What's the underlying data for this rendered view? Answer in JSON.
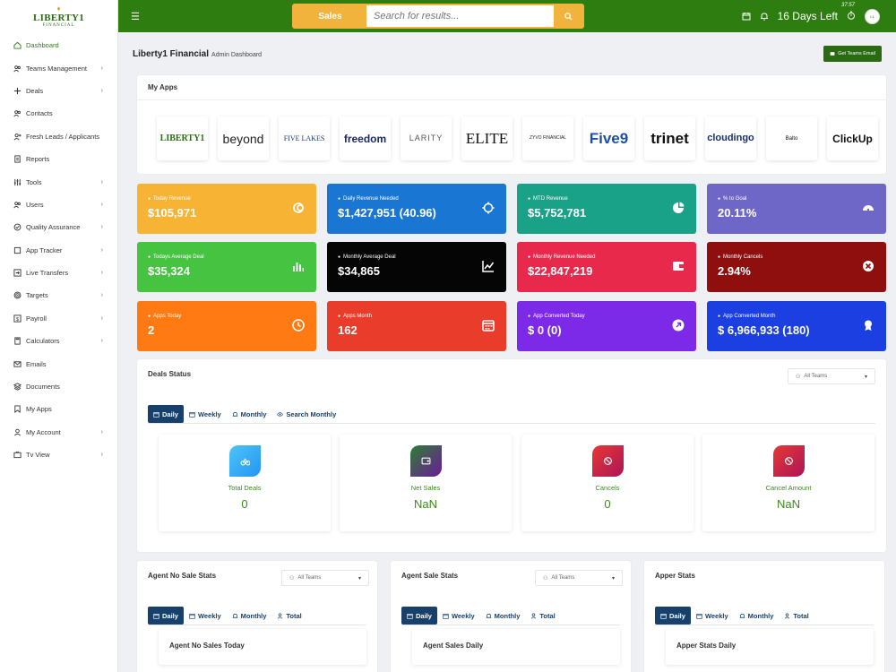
{
  "logo": {
    "top": "LIBERTY1",
    "bottom": "FINANCIAL"
  },
  "sidebar": {
    "items": [
      {
        "label": "Dashboard",
        "icon": "home-icon",
        "chevron": false
      },
      {
        "label": "Teams Management",
        "icon": "users-icon",
        "chevron": true
      },
      {
        "label": "Deals",
        "icon": "plus-icon",
        "chevron": true
      },
      {
        "label": "Contacts",
        "icon": "users-icon",
        "chevron": false
      },
      {
        "label": "Fresh Leads / Applicants",
        "icon": "user-plus-icon",
        "chevron": false
      },
      {
        "label": "Reports",
        "icon": "file-icon",
        "chevron": false
      },
      {
        "label": "Tools",
        "icon": "sliders-icon",
        "chevron": true
      },
      {
        "label": "Users",
        "icon": "users-icon",
        "chevron": true
      },
      {
        "label": "Quality Assurance",
        "icon": "check-circle-icon",
        "chevron": true
      },
      {
        "label": "App Tracker",
        "icon": "square-icon",
        "chevron": true
      },
      {
        "label": "Live Transfers",
        "icon": "transfer-icon",
        "chevron": true
      },
      {
        "label": "Targets",
        "icon": "target-icon",
        "chevron": true
      },
      {
        "label": "Payroll",
        "icon": "payroll-icon",
        "chevron": true
      },
      {
        "label": "Calculators",
        "icon": "calculator-icon",
        "chevron": true
      },
      {
        "label": "Emails",
        "icon": "mail-icon",
        "chevron": false
      },
      {
        "label": "Documents",
        "icon": "layers-icon",
        "chevron": false
      },
      {
        "label": "My Apps",
        "icon": "bookmark-icon",
        "chevron": false
      },
      {
        "label": "My Account",
        "icon": "user-icon",
        "chevron": true
      },
      {
        "label": "Tv View",
        "icon": "tv-icon",
        "chevron": true
      }
    ]
  },
  "header": {
    "search_category": "Sales",
    "search_placeholder": "Search for results...",
    "days_left": "16 Days Left",
    "clock_time": "37:57"
  },
  "page": {
    "title": "Liberty1 Financial",
    "subtitle": "Admin Dashboard",
    "email_button": "Get Teams Email"
  },
  "apps": {
    "title": "My Apps",
    "tiles": [
      "LIBERTY1",
      "beyond",
      "FIVE LAKES",
      "freedom",
      "LARITY",
      "ELITE",
      "ZYVO FINANCIAL",
      "Five9",
      "trinet",
      "cloudingo",
      "Balto",
      "ClickUp"
    ]
  },
  "stats": [
    {
      "label": "Today Revenue",
      "value": "$105,971",
      "color": "#f7b334"
    },
    {
      "label": "Daily Revenue Needed",
      "value": "$1,427,951 (40.96)",
      "color": "#1976d2"
    },
    {
      "label": "MTD Revenue",
      "value": "$5,752,781",
      "color": "#1aa289"
    },
    {
      "label": "% to Goal",
      "value": "20.11%",
      "color": "#6f67c7"
    },
    {
      "label": "Todays Average Deal",
      "value": "$35,324",
      "color": "#45c341"
    },
    {
      "label": "Monthly Average Deal",
      "value": "$34,865",
      "color": "#050505"
    },
    {
      "label": "Monthly Revenue Needed",
      "value": "$22,847,219",
      "color": "#e8294b"
    },
    {
      "label": "Monthly Cancels",
      "value": "2.94%",
      "color": "#8f0f0f"
    },
    {
      "label": "Apps Today",
      "value": "2",
      "color": "#ff7a12"
    },
    {
      "label": "Apps Month",
      "value": "162",
      "color": "#ea3c2a"
    },
    {
      "label": "App Converted Today",
      "value": "$ 0 (0)",
      "color": "#7d2ae8"
    },
    {
      "label": "App Converted Month",
      "value": "$ 6,966,933 (180)",
      "color": "#1b3fe0"
    }
  ],
  "deals": {
    "title": "Deals Status",
    "team_filter": "All Teams",
    "tabs": [
      "Daily",
      "Weekly",
      "Monthly",
      "Search Monthly"
    ],
    "metrics": [
      {
        "label": "Total Deals",
        "value": "0"
      },
      {
        "label": "Net Sales",
        "value": "NaN"
      },
      {
        "label": "Cancels",
        "value": "0"
      },
      {
        "label": "Cancel Amount",
        "value": "NaN"
      }
    ]
  },
  "panels": [
    {
      "title": "Agent No Sale Stats",
      "filter": "All Teams",
      "inner": "Agent No Sales Today"
    },
    {
      "title": "Agent Sale Stats",
      "filter": "All Teams",
      "inner": "Agent Sales Daily"
    },
    {
      "title": "Apper Stats",
      "filter": "",
      "inner": "Apper Stats Daily"
    }
  ],
  "panel_tabs": [
    "Daily",
    "Weekly",
    "Monthly",
    "Total"
  ]
}
